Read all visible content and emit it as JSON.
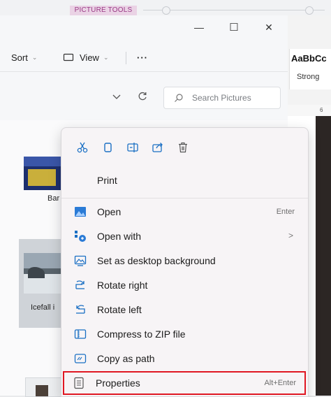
{
  "ribbon": {
    "contextual_tab": "PICTURE TOOLS"
  },
  "window": {
    "controls": {
      "minimize": "—",
      "maximize": "☐",
      "close": "✕"
    },
    "toolbar": {
      "sort_label": "Sort",
      "view_label": "View",
      "more_label": "···"
    },
    "address": {
      "search_placeholder": "Search Pictures"
    },
    "files": [
      {
        "name": "Bar"
      },
      {
        "name": "Icefall i"
      }
    ]
  },
  "word": {
    "style_sample": "AaBbCc",
    "style_name": "Strong",
    "ruler_mark": "6"
  },
  "context_menu": {
    "quick_actions": [
      {
        "name": "cut",
        "icon": "scissors-icon"
      },
      {
        "name": "copy",
        "icon": "copy-icon"
      },
      {
        "name": "rename",
        "icon": "rename-icon"
      },
      {
        "name": "share",
        "icon": "share-icon"
      },
      {
        "name": "delete",
        "icon": "trash-icon"
      }
    ],
    "items": [
      {
        "label": "Print",
        "shortcut": ""
      },
      {
        "label": "Open",
        "shortcut": "Enter"
      },
      {
        "label": "Open with",
        "shortcut": "",
        "has_submenu": true
      },
      {
        "label": "Set as desktop background",
        "shortcut": ""
      },
      {
        "label": "Rotate right",
        "shortcut": ""
      },
      {
        "label": "Rotate left",
        "shortcut": ""
      },
      {
        "label": "Compress to ZIP file",
        "shortcut": ""
      },
      {
        "label": "Copy as path",
        "shortcut": ""
      },
      {
        "label": "Properties",
        "shortcut": "Alt+Enter",
        "highlighted": true
      }
    ],
    "submenu_glyph": ">",
    "accent_color": "#1a6fc4",
    "highlight_color": "#e01722"
  }
}
